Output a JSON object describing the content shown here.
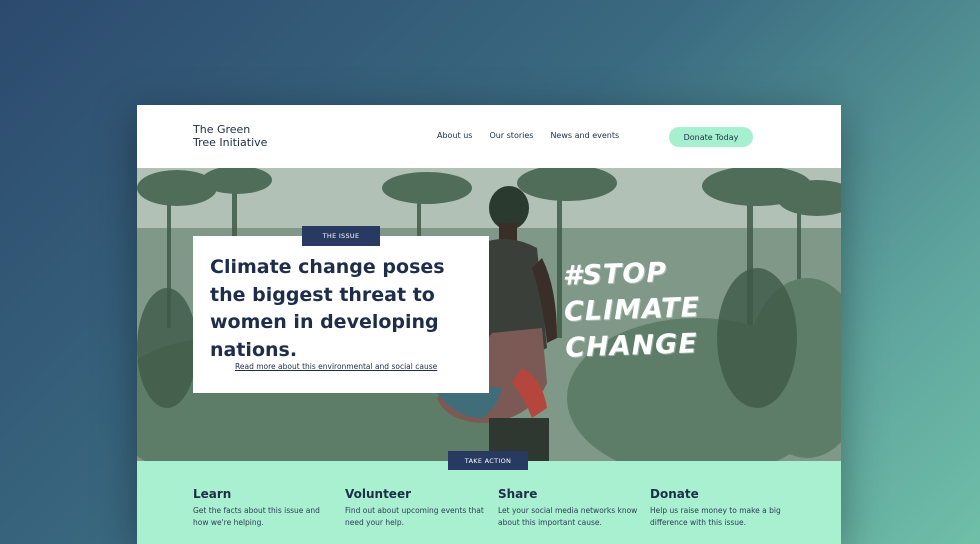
{
  "nav": {
    "logo_line1": "The Green",
    "logo_line2": "Tree Initiative",
    "links": [
      "About us",
      "Our stories",
      "News and events"
    ],
    "donate_label": "Donate Today"
  },
  "hero": {
    "tag": "THE ISSUE",
    "headline": "Climate change poses the biggest threat to women in developing nations.",
    "read_more": "Read more about this environmental and social cause",
    "stop_text": "#STOP\nCLIMATE\nCHANGE"
  },
  "take_action": {
    "tag": "TAKE ACTION",
    "columns": [
      {
        "title": "Learn",
        "text": "Get the facts about this issue and how we're helping."
      },
      {
        "title": "Volunteer",
        "text": "Find out about upcoming events that need your help."
      },
      {
        "title": "Share",
        "text": "Let your social media networks know about this important cause."
      },
      {
        "title": "Donate",
        "text": "Help us raise money to make a big difference with this issue."
      }
    ]
  },
  "colors": {
    "navy": "#1e2d4a",
    "tag_bg": "#283a61",
    "mint": "#a8f0cf",
    "button": "#a6f0cf"
  }
}
